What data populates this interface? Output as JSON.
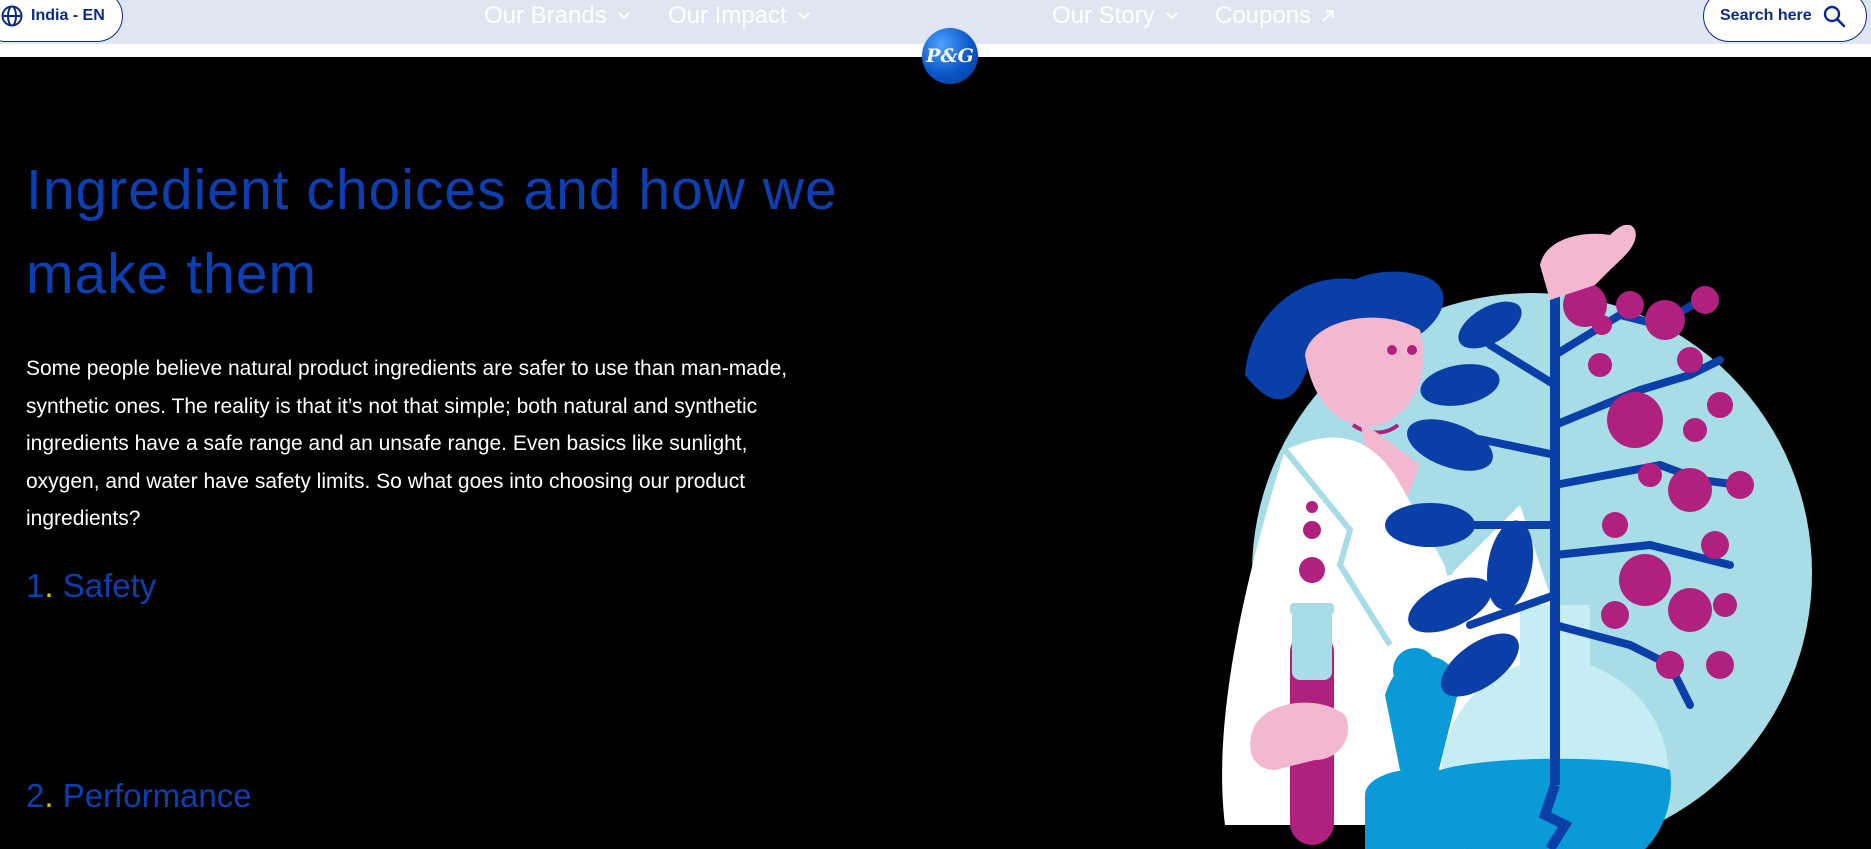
{
  "nav": {
    "language": "India - EN",
    "links": [
      {
        "label": "Our Brands",
        "icon": "chevron-down-icon"
      },
      {
        "label": "Our Impact",
        "icon": "chevron-down-icon"
      },
      {
        "label": "Our Story",
        "icon": "chevron-down-icon"
      },
      {
        "label": "Coupons",
        "icon": "arrow-up-right-icon"
      }
    ],
    "logo_text": "P&G",
    "search_label": "Search here"
  },
  "hero": {
    "title": "Ingredient choices and how we make them",
    "body": "Some people believe natural product ingredients are safer to use than man-made, synthetic ones. The reality is that it’s not that simple; both natural and synthetic ingredients have a safe range and an unsafe range. Even basics like sunlight, oxygen, and water have safety limits. So what goes into choosing our product ingredients?",
    "items": [
      {
        "num": "1",
        "sep": ".",
        "label": " Safety"
      },
      {
        "num": "2",
        "sep": ".",
        "label": " Performance"
      }
    ]
  },
  "colors": {
    "accent": "#0e3fb1",
    "nav_bg": "#dfe6f1",
    "page_bg": "#000000",
    "pink": "#f2b8d0",
    "magenta": "#b0207e",
    "light_blue": "#a8dde8"
  }
}
